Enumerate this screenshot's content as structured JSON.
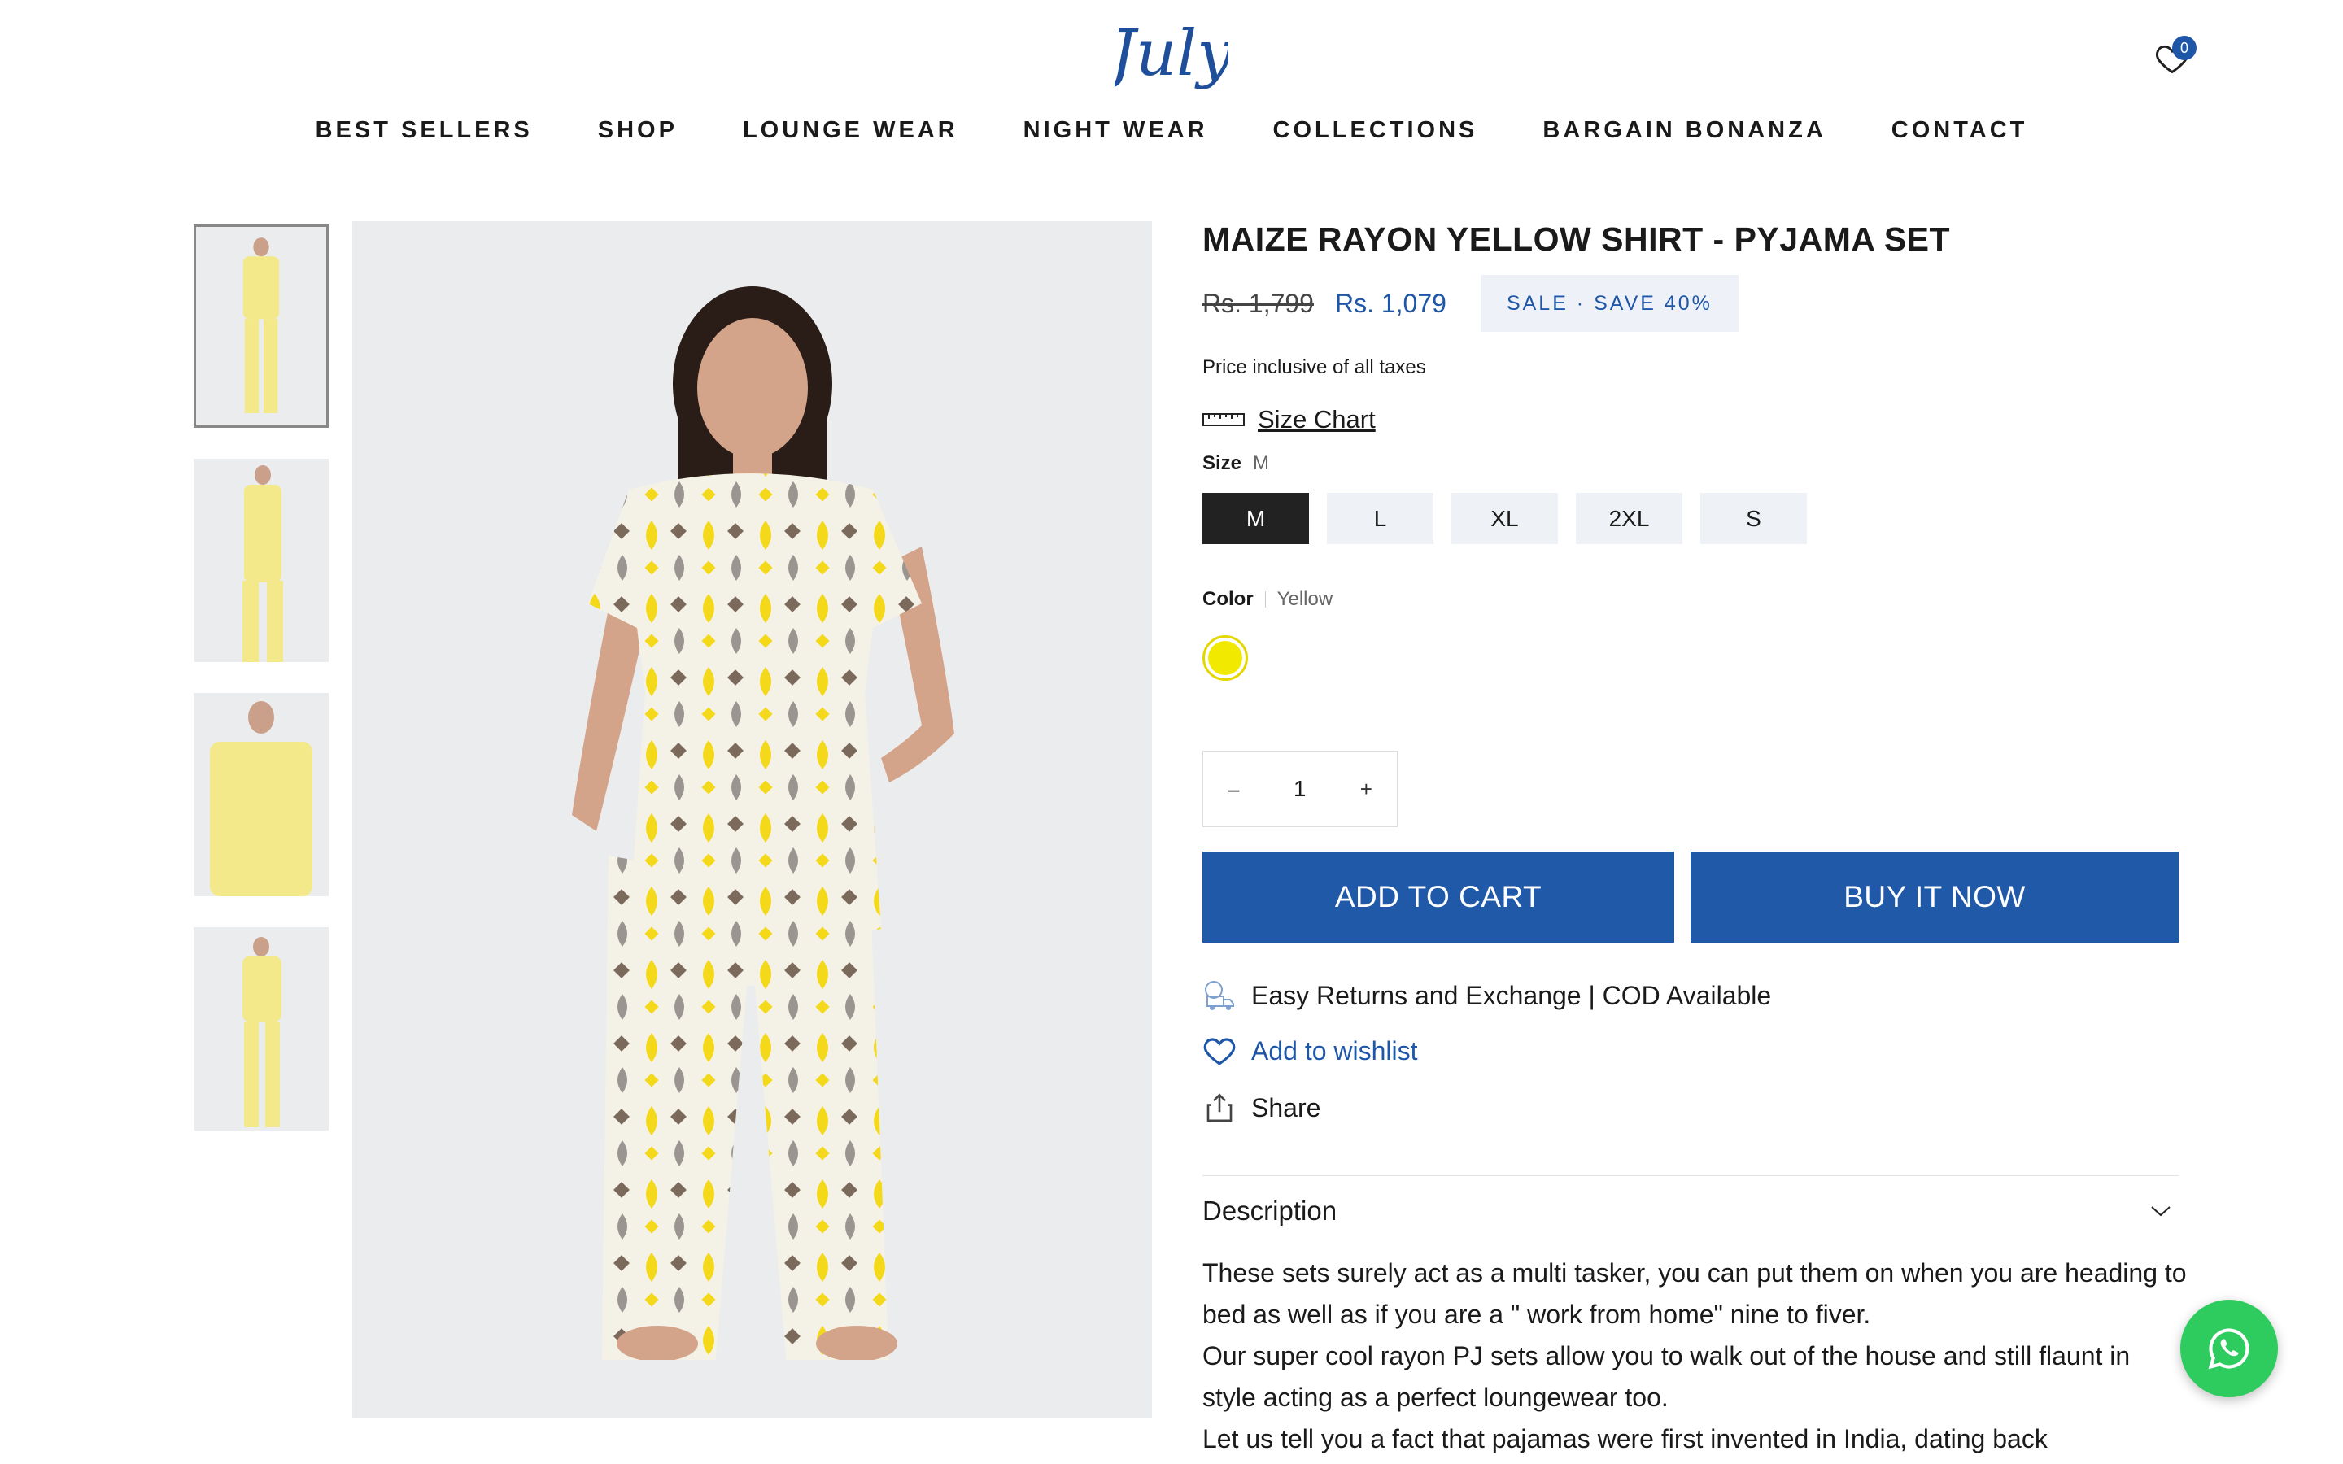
{
  "header": {
    "logo_text": "July",
    "wishlist_count": "0",
    "nav": [
      "BEST SELLERS",
      "SHOP",
      "LOUNGE WEAR",
      "NIGHT WEAR",
      "COLLECTIONS",
      "BARGAIN BONANZA",
      "CONTACT"
    ]
  },
  "product": {
    "title": "MAIZE RAYON YELLOW SHIRT - PYJAMA SET",
    "price_old": "Rs. 1,799",
    "price_new": "Rs. 1,079",
    "sale_badge": "SALE  ·  SAVE 40%",
    "tax_note": "Price inclusive of all taxes",
    "size_chart": "Size Chart",
    "size_label": "Size",
    "size_value": "M",
    "sizes": [
      "M",
      "L",
      "XL",
      "2XL",
      "S"
    ],
    "color_label": "Color",
    "color_value": "Yellow",
    "swatch_color": "#f1ea00",
    "quantity": "1",
    "qty_minus": "–",
    "qty_plus": "+",
    "add_to_cart": "ADD TO CART",
    "buy_now": "BUY IT NOW",
    "returns": "Easy Returns and Exchange | COD Available",
    "wishlist": "Add to wishlist",
    "share": "Share",
    "description_title": "Description",
    "description": [
      "These sets surely act as a multi tasker, you can put them on when you are heading to bed as well as if you are a \" work from home\" nine to fiver.",
      "Our super cool rayon PJ sets allow you to walk out of the house and still flaunt in style acting as a perfect loungewear too.",
      "Let us tell you a fact that pajamas were first invented in India, dating back"
    ]
  },
  "colors": {
    "accent": "#2159a9",
    "whatsapp": "#2ecc5f"
  }
}
